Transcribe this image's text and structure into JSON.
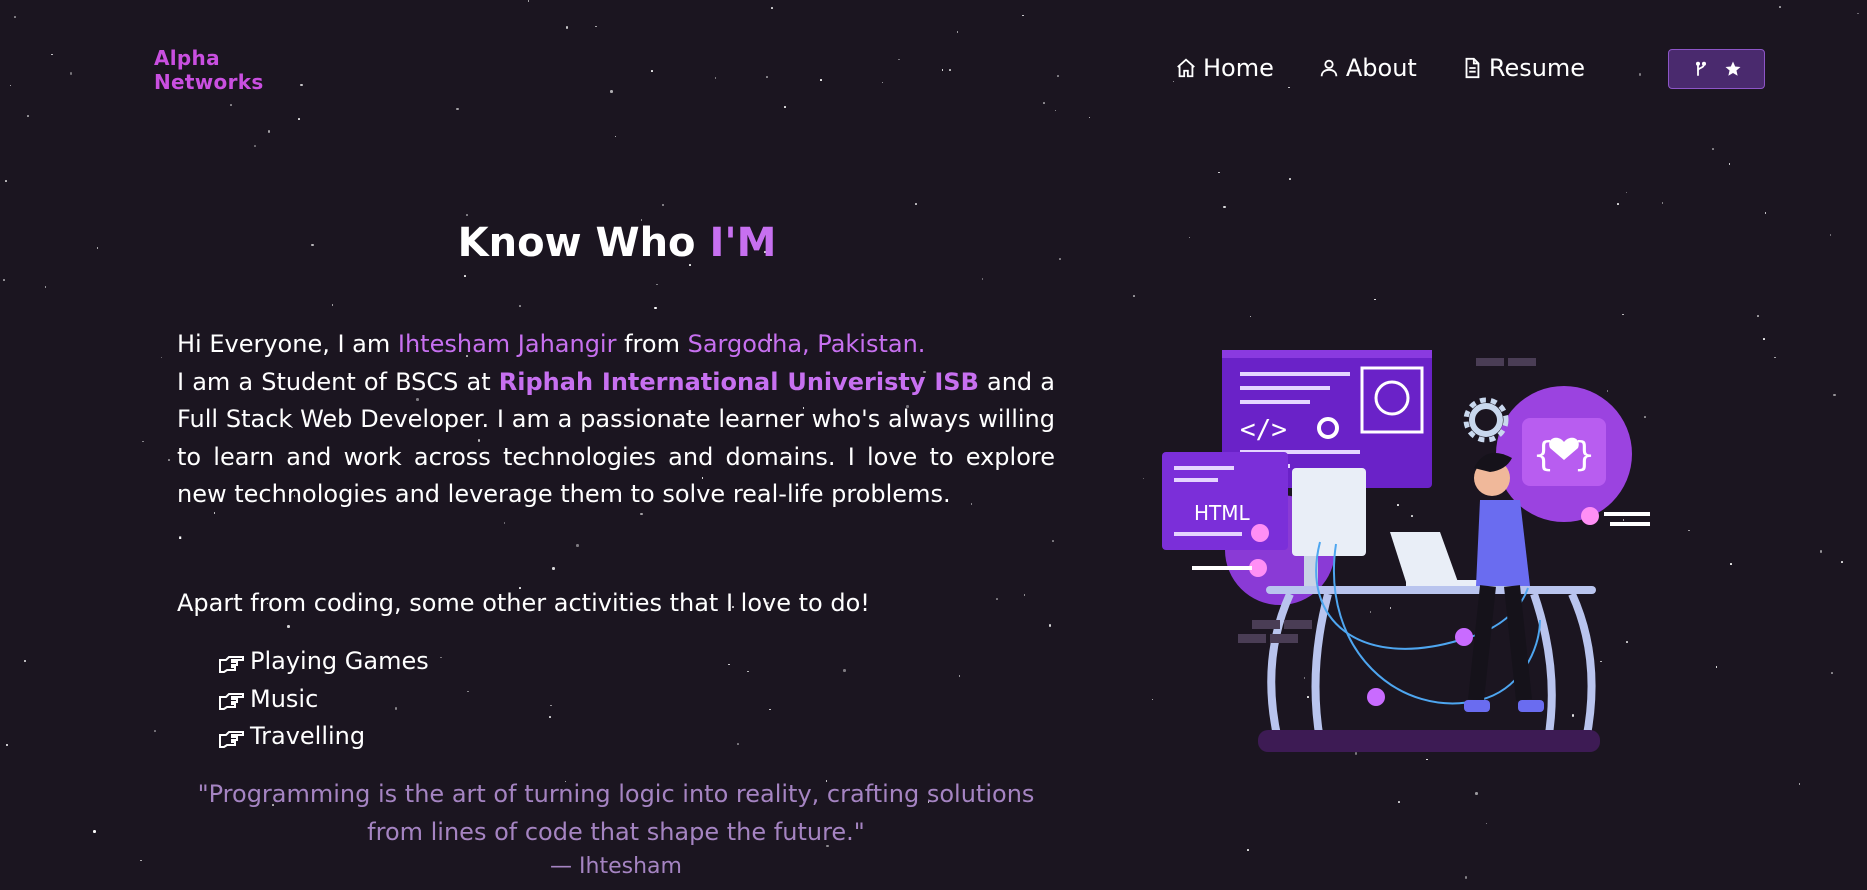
{
  "brand": {
    "line1": "Alpha",
    "line2": "Networks"
  },
  "nav": {
    "home": "Home",
    "about": "About",
    "resume": "Resume"
  },
  "heading": {
    "prefix": "Know Who ",
    "accent": "I'M"
  },
  "intro": {
    "p1_a": "Hi Everyone, I am ",
    "name": "Ihtesham Jahangir",
    "p1_b": " from ",
    "location": "Sargodha, Pakistan.",
    "p2_a": "I am a Student of BSCS at ",
    "university": "Riphah International Univeristy ISB",
    "p2_b": " and a Full Stack Web Developer. I am a passionate learner who's always willing to learn and work across technologies and domains. I love to explore new technologies and leverage them to solve real-life problems.",
    "dot": "."
  },
  "activities": {
    "title": "Apart from coding, some other activities that I love to do!",
    "items": [
      "Playing Games",
      "Music",
      "Travelling"
    ]
  },
  "quote": {
    "text": "\"Programming is the art of turning logic into reality, crafting solutions from lines of code that shape the future.\"",
    "author": "— Ihtesham"
  },
  "illustration": {
    "html_label": "HTML"
  },
  "colors": {
    "background": "#1b1520",
    "accent": "#c770f0",
    "logo": "#c94fe0",
    "quote": "#a584c2",
    "button_bg": "#4a2a6e"
  },
  "icons": {
    "home": "home-icon",
    "about": "user-icon",
    "resume": "document-icon",
    "fork": "git-fork-icon",
    "star": "star-icon",
    "pointer": "hand-pointer-icon"
  }
}
